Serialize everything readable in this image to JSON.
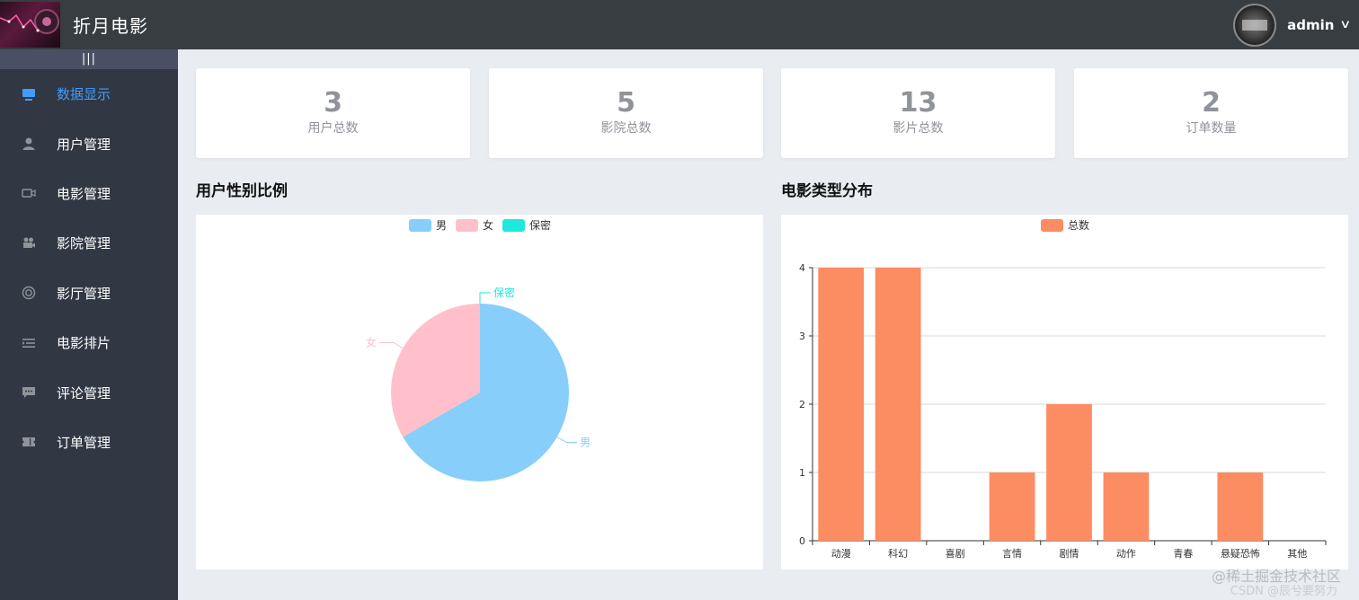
{
  "app": {
    "title": "折月电影"
  },
  "user": {
    "name": "admin"
  },
  "sidebar": {
    "toggle_label": "|||",
    "items": [
      {
        "label": "数据显示",
        "icon": "monitor-icon",
        "active": true
      },
      {
        "label": "用户管理",
        "icon": "user-icon",
        "active": false
      },
      {
        "label": "电影管理",
        "icon": "video-camera-icon",
        "active": false
      },
      {
        "label": "影院管理",
        "icon": "film-camera-icon",
        "active": false
      },
      {
        "label": "影厅管理",
        "icon": "help-ring-icon",
        "active": false
      },
      {
        "label": "电影排片",
        "icon": "list-icon",
        "active": false
      },
      {
        "label": "评论管理",
        "icon": "comment-icon",
        "active": false
      },
      {
        "label": "订单管理",
        "icon": "ticket-icon",
        "active": false
      }
    ]
  },
  "stats": [
    {
      "value": "3",
      "label": "用户总数"
    },
    {
      "value": "5",
      "label": "影院总数"
    },
    {
      "value": "13",
      "label": "影片总数"
    },
    {
      "value": "2",
      "label": "订单数量"
    }
  ],
  "sections": {
    "gender_title": "用户性别比例",
    "genre_title": "电影类型分布"
  },
  "chart_data": [
    {
      "type": "pie",
      "categories": [
        "男",
        "女",
        "保密"
      ],
      "values": [
        2,
        1,
        0
      ],
      "colors": [
        "#87cefa",
        "#ffc0cb",
        "#1de9dc"
      ],
      "legend": "top"
    },
    {
      "type": "bar",
      "categories": [
        "动漫",
        "科幻",
        "喜剧",
        "言情",
        "剧情",
        "动作",
        "青春",
        "悬疑恐怖",
        "其他"
      ],
      "series": [
        {
          "name": "总数",
          "values": [
            4,
            4,
            0,
            1,
            2,
            1,
            0,
            1,
            0
          ]
        }
      ],
      "ylim": [
        0,
        4
      ],
      "yticks": [
        "0",
        "1",
        "2",
        "3",
        "4"
      ],
      "grid": true,
      "color": "#fc8c62",
      "legend": "top"
    }
  ],
  "watermark": {
    "line1": "@稀土掘金技术社区",
    "line2": "CSDN @辰兮要努力"
  }
}
